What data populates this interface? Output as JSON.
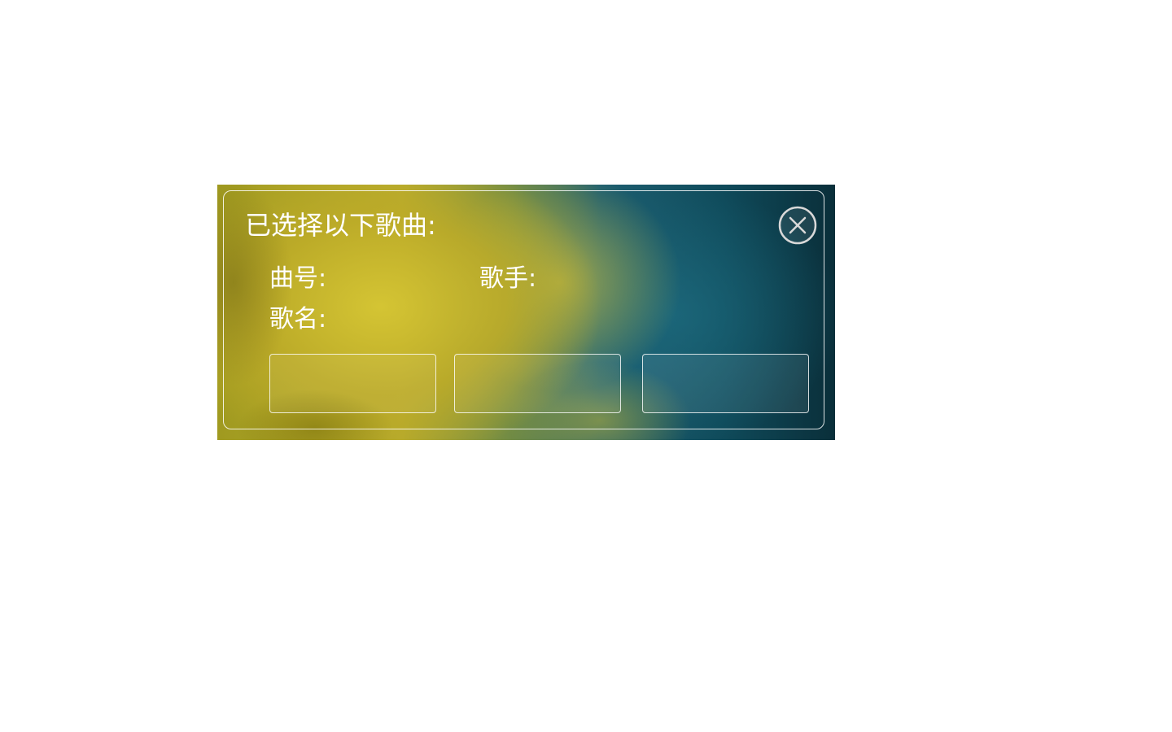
{
  "dialog": {
    "title": "已选择以下歌曲:",
    "close_icon": "close-circle-icon",
    "fields": {
      "track_no_label": "曲号:",
      "track_no_value": "",
      "singer_label": "歌手:",
      "singer_value": "",
      "song_name_label": "歌名:",
      "song_name_value": ""
    },
    "buttons": [
      {
        "label": ""
      },
      {
        "label": ""
      },
      {
        "label": ""
      }
    ]
  }
}
